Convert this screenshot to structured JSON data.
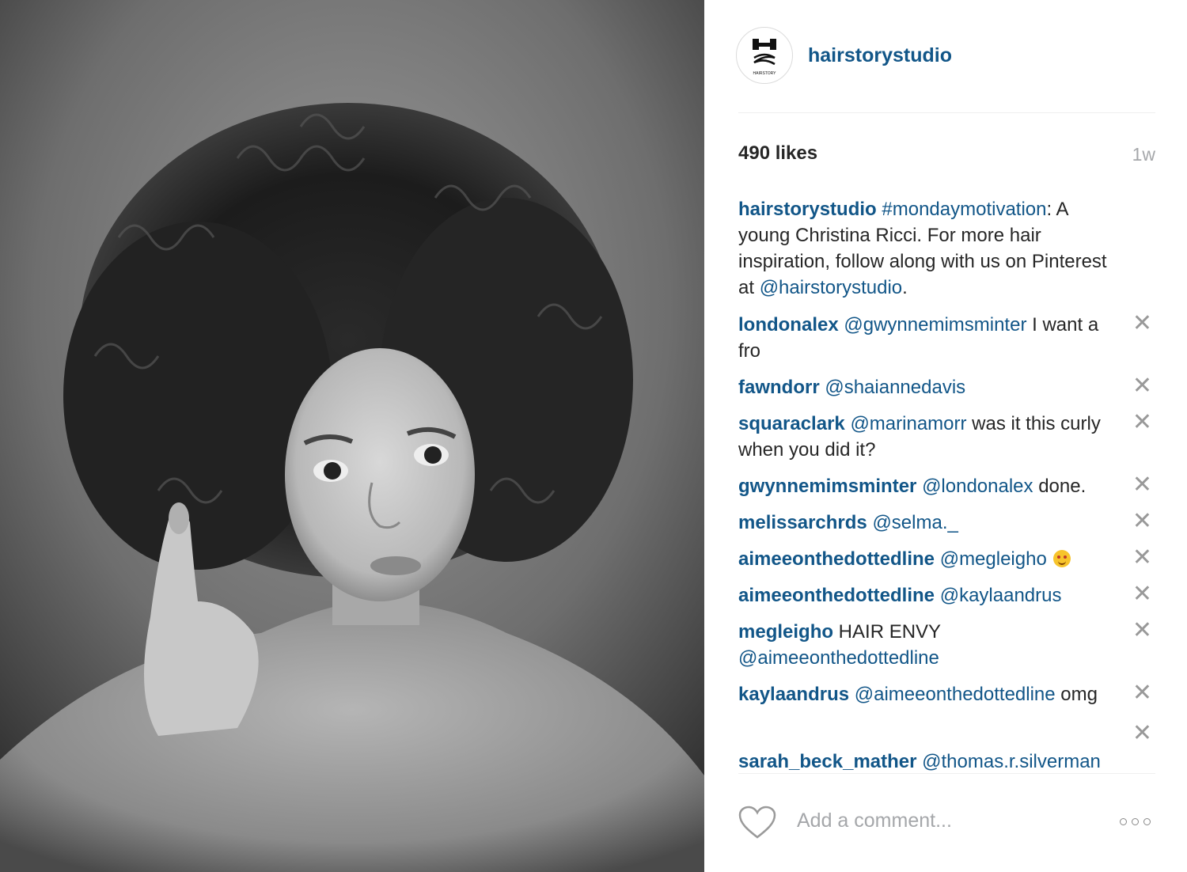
{
  "post": {
    "username": "hairstorystudio",
    "likes": "490 likes",
    "time": "1w",
    "caption": {
      "user": "hairstorystudio",
      "hashtag": "#mondaymotivation",
      "text1": ": A young Christina Ricci. For more hair inspiration, follow along with us on Pinterest at ",
      "mention": "@hairstorystudio",
      "text2": "."
    },
    "comments": [
      {
        "user": "londonalex",
        "mention": "@gwynnemimsminter",
        "text": " I want a fro"
      },
      {
        "user": "fawndorr",
        "mention": "@shaiannedavis",
        "text": ""
      },
      {
        "user": "squaraclark",
        "mention": "@marinamorr",
        "text": " was it this curly when you did it?"
      },
      {
        "user": "gwynnemimsminter",
        "mention": "@londonalex",
        "text": " done."
      },
      {
        "user": "melissarchrds",
        "mention": "@selma._",
        "text": ""
      },
      {
        "user": "aimeeonthedottedline",
        "mention": "@megleigho",
        "text": ""
      },
      {
        "user": "aimeeonthedottedline",
        "mention": "@kaylaandrus",
        "text": ""
      },
      {
        "user": "megleigho",
        "mention": "@aimeeonthedottedline",
        "text": " HAIR ENVY"
      },
      {
        "user": "kaylaandrus",
        "mention": "@aimeeonthedottedline",
        "text": " omg"
      },
      {
        "user": "sarah_beck_mather",
        "mention": "@thomas.r.silverman",
        "text": ""
      }
    ],
    "remove_glyph": "✕",
    "add_comment_placeholder": "Add a comment...",
    "avatar_logo_text": "HAIRSTORY"
  },
  "colors": {
    "link": "#125688",
    "muted": "#a5a7aa"
  },
  "icons": [
    "heart-icon",
    "more-options-icon",
    "remove-comment-icon",
    "heart-eyes-cat-emoji"
  ]
}
